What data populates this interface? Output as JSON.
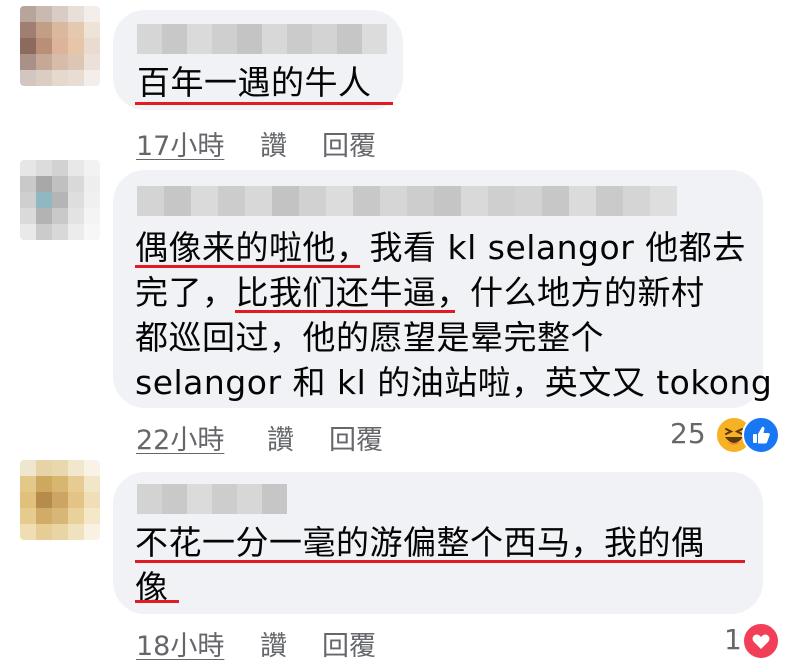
{
  "comments": [
    {
      "text": "百年一遇的牛人",
      "time": "17小時",
      "like": "讚",
      "reply": "回覆"
    },
    {
      "lines": [
        "偶像来的啦他，我看 kl selangor 他都去",
        "完了，比我们还牛逼，什么地方的新村",
        "都巡回过，他的愿望是晕完整个",
        "selangor 和 kl 的油站啦，英文又 tokong"
      ],
      "time": "22小時",
      "like": "讚",
      "reply": "回覆",
      "reaction_count": "25",
      "reactions": [
        "haha-icon",
        "like-icon"
      ]
    },
    {
      "lines": [
        "不花一分一毫的游偏整个西马，我的偶",
        "像"
      ],
      "time": "18小時",
      "like": "讚",
      "reply": "回覆",
      "reaction_count": "1",
      "reactions": [
        "love-icon"
      ]
    }
  ],
  "colors": {
    "bubble": "#f0f2f5",
    "underline": "#e31a22",
    "meta": "#65676b",
    "text": "#050505",
    "like": "#1877f2",
    "haha": "#f7b125",
    "love": "#f33e58"
  }
}
